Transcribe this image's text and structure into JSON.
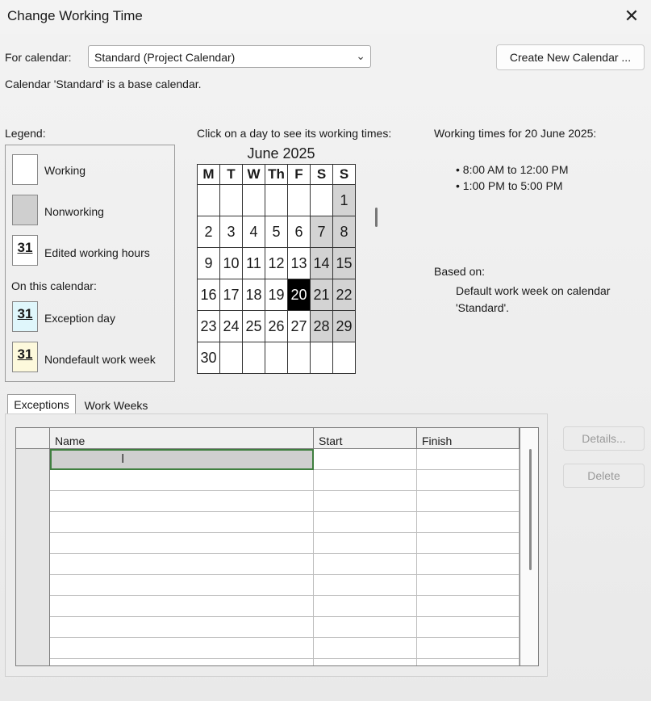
{
  "window": {
    "title": "Change Working Time"
  },
  "for_calendar": {
    "label": "For calendar:",
    "value": "Standard (Project Calendar)",
    "base_note": "Calendar 'Standard' is a base calendar."
  },
  "create_new_calendar_label": "Create New Calendar ...",
  "legend": {
    "title": "Legend:",
    "working": "Working",
    "nonworking": "Nonworking",
    "edited_hours": "Edited working hours",
    "on_this_calendar": "On this calendar:",
    "exception_day": "Exception day",
    "nondefault_week": "Nondefault work week",
    "swatch_number": "31",
    "colors": {
      "nonworking": "#cfcfcf",
      "exception": "#dff6fb",
      "nondefault": "#fdf9dc"
    }
  },
  "calendar": {
    "instruction": "Click on a day to see its working times:",
    "month_title": "June 2025",
    "weekdays": [
      "M",
      "T",
      "W",
      "Th",
      "F",
      "S",
      "S"
    ],
    "weeks": [
      [
        "",
        "",
        "",
        "",
        "",
        "",
        "1"
      ],
      [
        "2",
        "3",
        "4",
        "5",
        "6",
        "7",
        "8"
      ],
      [
        "9",
        "10",
        "11",
        "12",
        "13",
        "14",
        "15"
      ],
      [
        "16",
        "17",
        "18",
        "19",
        "20",
        "21",
        "22"
      ],
      [
        "23",
        "24",
        "25",
        "26",
        "27",
        "28",
        "29"
      ],
      [
        "30",
        "",
        "",
        "",
        "",
        "",
        ""
      ]
    ],
    "selected_day": "20"
  },
  "working_times": {
    "title": "Working times for 20 June 2025:",
    "times": [
      "• 8:00 AM to 12:00 PM",
      "• 1:00 PM to 5:00 PM"
    ],
    "based_on_label": "Based on:",
    "based_on_line1": "Default work week on calendar",
    "based_on_line2": "'Standard'."
  },
  "tabs": {
    "exceptions": "Exceptions",
    "work_weeks": "Work Weeks"
  },
  "exceptions_grid": {
    "columns": [
      "Name",
      "Start",
      "Finish"
    ],
    "row_count": 11
  },
  "buttons": {
    "details": "Details...",
    "delete": "Delete"
  }
}
